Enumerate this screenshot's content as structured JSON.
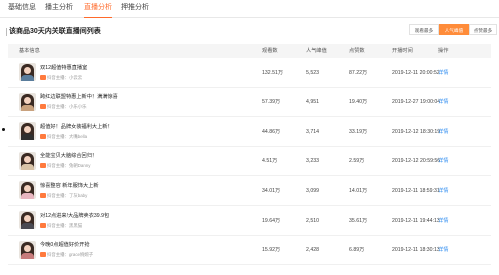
{
  "tabs": [
    "基础信息",
    "播主分析",
    "直播分析",
    "押推分析"
  ],
  "active_tab": 2,
  "section_title": "该商品30天内关联直播间列表",
  "sort_buttons": {
    "labels": [
      "观看最多",
      "人气峰值",
      "点赞最多"
    ],
    "active": 1
  },
  "table": {
    "columns": [
      "基本信息",
      "观看数",
      "人气峰值",
      "点赞数",
      "开播时间",
      "操作"
    ],
    "host_prefix": "抖音主播：",
    "detail_label": "详情",
    "rows": [
      {
        "title": "双12超值特惠直播室",
        "host": "小云云",
        "views": "132.51万",
        "peak": "5,523",
        "likes": "87.22万",
        "start_time": "2019-12-11 20:00:52",
        "thumb_color": "#5a7d9c"
      },
      {
        "title": "跨红边联盟特惠上新中！满满惊喜",
        "host": "小乐小乐",
        "views": "57.39万",
        "peak": "4,951",
        "likes": "19.40万",
        "start_time": "2019-12-27 19:00:04",
        "thumb_color": "#c9a27e"
      },
      {
        "title": "超值好！品牌女装福利大上新！",
        "host": "大嘴bella",
        "views": "44.86万",
        "peak": "3,714",
        "likes": "33.19万",
        "start_time": "2019-12-12 18:30:19",
        "thumb_color": "#2f2f2f"
      },
      {
        "title": "全能宝贝大脑综合回归！",
        "host": "兔朝Danny",
        "views": "4.51万",
        "peak": "3,233",
        "likes": "2.59万",
        "start_time": "2019-12-12 20:59:56",
        "thumb_color": "#d9c4a8"
      },
      {
        "title": "惊喜整容 新年服饰大上新",
        "host": "了灰baby",
        "views": "34.01万",
        "peak": "3,099",
        "likes": "14.01万",
        "start_time": "2019-12-11 18:59:31",
        "thumb_color": "#e8b6c0"
      },
      {
        "title": "对12点进来!大品牌卖衣39.9包",
        "host": "黑黑猫",
        "views": "19.64万",
        "peak": "2,510",
        "likes": "35.61万",
        "start_time": "2019-12-11 19:44:13",
        "thumb_color": "#4a4a52"
      },
      {
        "title": "今晚0点超值好价开抢",
        "host": "grace婉婉子",
        "views": "15.92万",
        "peak": "2,428",
        "likes": "6.89万",
        "start_time": "2019-12-11 18:30:13",
        "thumb_color": "#c77b7b"
      }
    ]
  }
}
